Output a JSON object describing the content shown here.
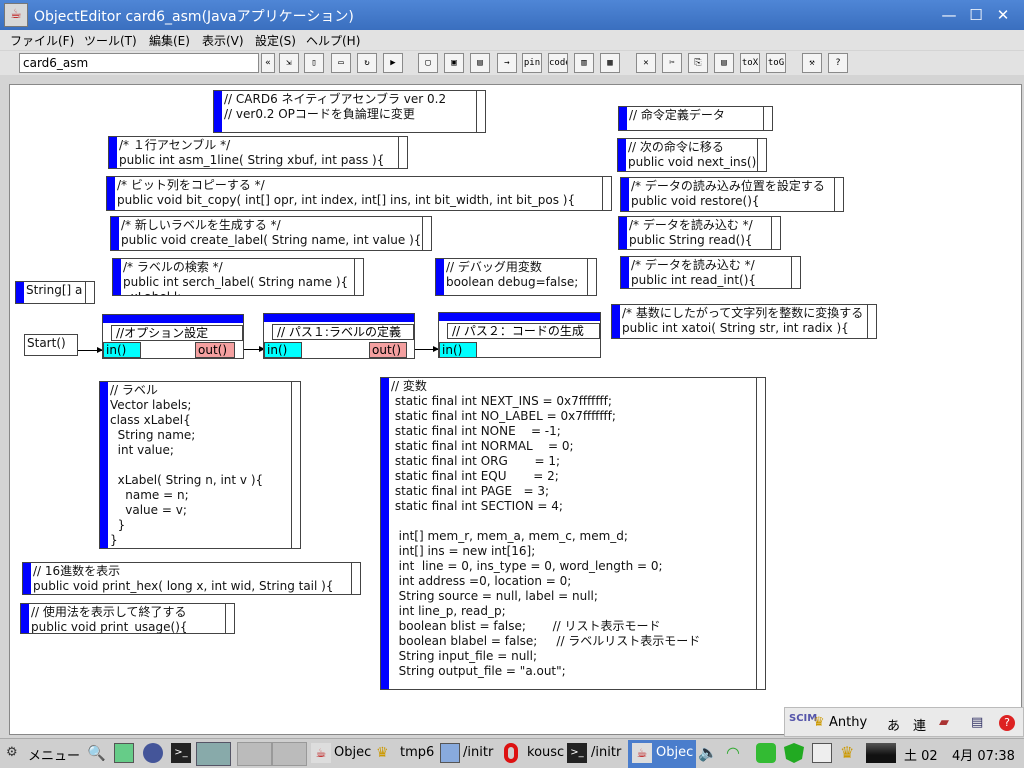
{
  "window": {
    "title": "ObjectEditor card6_asm(Javaアプリケーション)"
  },
  "menu": [
    "ファイル(F)",
    "ツール(T)",
    "編集(E)",
    "表示(V)",
    "設定(S)",
    "ヘルプ(H)"
  ],
  "toolbar": {
    "combo_value": "card6_asm",
    "nav_back": "«",
    "t_pin": "pin",
    "t_code": "code",
    "t_tox": "toX",
    "t_tog": "toG",
    "t_help": "?"
  },
  "boxes": {
    "header": "// CARD6 ネイティブアセンブラ ver 0.2\n// ver0.2 OPコードを負論理に変更",
    "asm1line": "/* １行アセンブル */\npublic int asm_1line( String xbuf, int pass ){",
    "bitcopy": "/* ビット列をコピーする */\npublic void bit_copy( int[] opr, int index, int[] ins, int bit_width, int bit_pos ){",
    "createlabel": "/* 新しいラベルを生成する */\npublic void create_label( String name, int value ){",
    "serchlabel": "/* ラベルの検索 */\npublic int serch_label( String name ){\n  xLabel l;",
    "debug": "// デバッグ用変数\nboolean debug=false;",
    "opdef": "// 命令定義データ",
    "nextins": "// 次の命令に移る\npublic void next_ins()",
    "restore": "/* データの読み込み位置を設定する\npublic void restore(){",
    "read": "/* データを読み込む */\npublic String read(){",
    "readint": "/* データを読み込む */\npublic int read_int(){",
    "xatoi": "/* 基数にしたがって文字列を整数に変換する\npublic int xatoi( String str, int radix ){",
    "args": "String[] a",
    "label": "// ラベル\nVector labels;\nclass xLabel{\n  String name;\n  int value;\n\n  xLabel( String n, int v ){\n    name = n;\n    value = v;\n  }\n}",
    "vars": "// 変数\n static final int NEXT_INS = 0x7fffffff;\n static final int NO_LABEL = 0x7fffffff;\n static final int NONE    = -1;\n static final int NORMAL    = 0;\n static final int ORG       = 1;\n static final int EQU       = 2;\n static final int PAGE   = 3;\n static final int SECTION = 4;\n\n  int[] mem_r, mem_a, mem_c, mem_d;\n  int[] ins = new int[16];\n  int  line = 0, ins_type = 0, word_length = 0;\n  int address =0, location = 0;\n  String source = null, label = null;\n  int line_p, read_p;\n  boolean blist = false;       // リスト表示モード\n  boolean blabel = false;     // ラベルリスト表示モード\n  String input_file = null;\n  String output_file = \"a.out\";",
    "printhex": "// 16進数を表示\npublic void print_hex( long x, int wid, String tail ){",
    "usage": "// 使用法を表示して終了する\npublic void print_usage(){"
  },
  "flow": {
    "start": "Start()",
    "pass0": "//オプション設定",
    "pass1": "// パス１:ラベルの定義",
    "pass2": "// パス２：コードの生成",
    "in_label": "in()",
    "out_label": "out()"
  },
  "ime": {
    "logo": "SCIM",
    "name": "Anthy",
    "mode1": "あ",
    "mode2": "連"
  },
  "taskbar": {
    "menu": "メニュー",
    "tasks": [
      "Objec",
      "tmp6",
      "/initr",
      "kousc",
      "/initr",
      "Objec"
    ],
    "date": "土 02",
    "time": "4月 07:38"
  },
  "colors": {
    "accent": "#0000ff",
    "in_port": "#00ffff",
    "out_port": "#f4a0a0",
    "titlebar": "#4a7dcc"
  }
}
